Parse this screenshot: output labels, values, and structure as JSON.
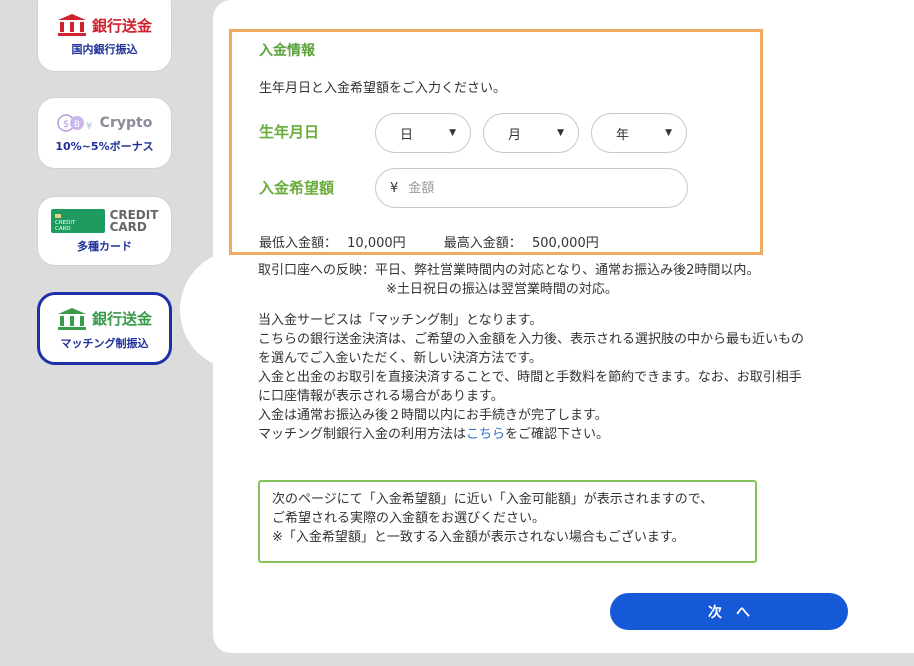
{
  "sidebar": {
    "bank": {
      "title": "銀行送金",
      "sub": "国内銀行振込",
      "color": "#d0212e"
    },
    "crypto": {
      "title": "Crypto",
      "sub": "10%~5%ボーナス"
    },
    "credit": {
      "line1": "CREDIT",
      "line2": "CARD",
      "sub": "多種カード",
      "card_text1": "CREDIT",
      "card_text2": "CARD"
    },
    "matching": {
      "title": "銀行送金",
      "sub": "マッチング制振込"
    }
  },
  "form": {
    "section_title": "入金情報",
    "instruction": "生年月日と入金希望額をご入力ください。",
    "dob_label": "生年月日",
    "day": "日",
    "month": "月",
    "year": "年",
    "amount_label": "入金希望額",
    "currency": "¥",
    "amount_placeholder": "金額",
    "min_label": "最低入金額：",
    "min_value": "10,000円",
    "max_label": "最高入金額：",
    "max_value": "500,000円"
  },
  "notes": {
    "reflect_line1": "取引口座への反映：平日、弊社営業時間内の対応となり、通常お振込み後2時間以内。",
    "reflect_line2": "※土日祝日の振込は翌営業時間の対応。",
    "desc1": "当入金サービスは「マッチング制」となります。",
    "desc2": "こちらの銀行送金決済は、ご希望の入金額を入力後、表示される選択肢の中から最も近いもの",
    "desc3": "を選んでご入金いただく、新しい決済方法です。",
    "desc4": "入金と出金のお取引を直接決済することで、時間と手数料を節約できます。なお、お取引相手",
    "desc5": "に口座情報が表示される場合があります。",
    "desc6": "入金は通常お振込み後２時間以内にお手続きが完了します。",
    "desc7_pre": "マッチング制銀行入金の利用方法は",
    "desc7_link": "こちら",
    "desc7_post": "をご確認下さい。"
  },
  "notice": {
    "line1": "次のページにて「入金希望額」に近い「入金可能額」が表示されますので、",
    "line2": "ご希望される実際の入金額をお選びください。",
    "line3": "※「入金希望額」と一致する入金額が表示されない場合もございます。"
  },
  "next_button": {
    "label": "次",
    "arrow": "へ",
    "color": "#1559d6"
  },
  "colors": {
    "accent_orange": "#f0ab63",
    "accent_green": "#6aab3e",
    "selected_border": "#1f2fa8"
  }
}
